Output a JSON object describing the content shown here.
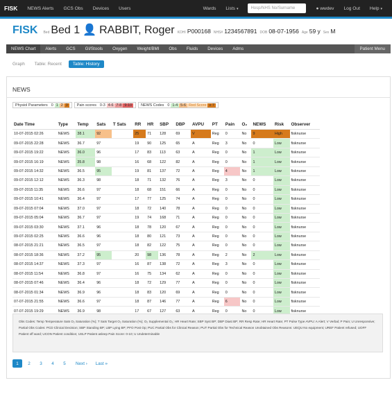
{
  "topnav": {
    "brand": "FISK",
    "left_items": [
      "NEWS Alerts",
      "GCS Obs",
      "Devices",
      "Users"
    ],
    "right_items": [
      "Wards",
      "Lists"
    ],
    "search_placeholder": "Hosp/NHS No/Surname",
    "user": "wwdev",
    "logout": "Log Out",
    "help": "Help"
  },
  "patient": {
    "ward": "FISK",
    "bed_label": "Bed",
    "bed": "Bed 1",
    "name": "RABBIT, Roger",
    "koha_label": "KOHI",
    "koha": "P000168",
    "nhs_label": "NHS#",
    "nhs": "1234567891",
    "dob_label": "DOB",
    "dob": "08-07-1956",
    "age_label": "Age",
    "age": "59 y",
    "sex_label": "Sex",
    "sex": "M"
  },
  "subnav": {
    "items": [
      "NEWS Chart",
      "Alerts",
      "GCS",
      "GI/Stools",
      "Oxygen",
      "Weight/BMI",
      "Obs",
      "Fluids",
      "Devices",
      "Adms"
    ],
    "patient_menu": "Patient Menu"
  },
  "tabs": [
    "Graph",
    "Table: Recent",
    "Table: History"
  ],
  "section_title": "NEWS",
  "legend": {
    "physiol_label": "Physiol Parameters",
    "physiol": [
      "0",
      "1",
      "2",
      "3"
    ],
    "pain_label": "Pain scores",
    "pain": [
      "0-3",
      "4-6",
      "7-8",
      "9-10"
    ],
    "codes_label": "NEWS Codes",
    "codes": [
      "0",
      "1-4",
      "5-6",
      "Red Score",
      "≥ 7"
    ]
  },
  "table": {
    "headers": [
      "Date Time",
      "Type",
      "Temp",
      "Sats",
      "T Sats",
      "RR",
      "HR",
      "SBP",
      "DBP",
      "AVPU",
      "PT",
      "Pain",
      "O₂",
      "NEWS",
      "Risk",
      "Observer"
    ],
    "rows": [
      [
        "10-07-2015 02:26",
        "NEWS",
        "38.1",
        "92",
        "",
        "25",
        "71",
        "128",
        "69",
        "V",
        "Reg",
        "0",
        "No",
        "9",
        "High",
        "fisknurse"
      ],
      [
        "09-07-2015 22:28",
        "NEWS",
        "36.7",
        "97",
        "",
        "19",
        "90",
        "125",
        "65",
        "A",
        "Reg",
        "3",
        "No",
        "0",
        "Low",
        "fisknurse"
      ],
      [
        "09-07-2015 19:22",
        "NEWS",
        "36.0",
        "96",
        "",
        "17",
        "83",
        "113",
        "63",
        "A",
        "Reg",
        "0",
        "No",
        "1",
        "Low",
        "fisknurse"
      ],
      [
        "09-07-2015 16:19",
        "NEWS",
        "35.8",
        "98",
        "",
        "16",
        "68",
        "122",
        "82",
        "A",
        "Reg",
        "0",
        "No",
        "1",
        "Low",
        "fisknurse"
      ],
      [
        "09-07-2015 14:32",
        "NEWS",
        "36.5",
        "95",
        "",
        "19",
        "81",
        "137",
        "72",
        "A",
        "Reg",
        "4",
        "No",
        "1",
        "Low",
        "fisknurse"
      ],
      [
        "09-07-2015 12:12",
        "NEWS",
        "36.3",
        "98",
        "",
        "18",
        "71",
        "132",
        "76",
        "A",
        "Reg",
        "3",
        "No",
        "0",
        "Low",
        "fisknurse"
      ],
      [
        "09-07-2015 11:35",
        "NEWS",
        "36.6",
        "97",
        "",
        "18",
        "68",
        "151",
        "66",
        "A",
        "Reg",
        "0",
        "No",
        "0",
        "Low",
        "fisknurse"
      ],
      [
        "09-07-2015 10:41",
        "NEWS",
        "36.4",
        "97",
        "",
        "17",
        "77",
        "125",
        "74",
        "A",
        "Reg",
        "0",
        "No",
        "0",
        "Low",
        "fisknurse"
      ],
      [
        "09-07-2015 07:04",
        "NEWS",
        "37.0",
        "97",
        "",
        "18",
        "72",
        "140",
        "78",
        "A",
        "Reg",
        "0",
        "No",
        "0",
        "Low",
        "fisknurse"
      ],
      [
        "09-07-2015 05:04",
        "NEWS",
        "36.7",
        "97",
        "",
        "19",
        "74",
        "168",
        "71",
        "A",
        "Reg",
        "0",
        "No",
        "0",
        "Low",
        "fisknurse"
      ],
      [
        "09-07-2015 03:30",
        "NEWS",
        "37.1",
        "96",
        "",
        "18",
        "78",
        "120",
        "67",
        "A",
        "Reg",
        "0",
        "No",
        "0",
        "Low",
        "fisknurse"
      ],
      [
        "09-07-2015 02:25",
        "NEWS",
        "36.6",
        "96",
        "",
        "18",
        "80",
        "121",
        "73",
        "A",
        "Reg",
        "0",
        "No",
        "0",
        "Low",
        "fisknurse"
      ],
      [
        "08-07-2015 21:21",
        "NEWS",
        "36.5",
        "97",
        "",
        "18",
        "82",
        "122",
        "75",
        "A",
        "Reg",
        "0",
        "No",
        "0",
        "Low",
        "fisknurse"
      ],
      [
        "08-07-2015 18:36",
        "NEWS",
        "37.2",
        "95",
        "",
        "20",
        "98",
        "136",
        "78",
        "A",
        "Reg",
        "2",
        "No",
        "2",
        "Low",
        "fisknurse"
      ],
      [
        "08-07-2015 14:37",
        "NEWS",
        "37.3",
        "97",
        "",
        "16",
        "87",
        "138",
        "72",
        "A",
        "Reg",
        "3",
        "No",
        "0",
        "Low",
        "fisknurse"
      ],
      [
        "08-07-2015 11:54",
        "NEWS",
        "36.8",
        "97",
        "",
        "16",
        "75",
        "134",
        "62",
        "A",
        "Reg",
        "0",
        "No",
        "0",
        "Low",
        "fisknurse"
      ],
      [
        "08-07-2015 07:46",
        "NEWS",
        "36.4",
        "96",
        "",
        "18",
        "72",
        "129",
        "77",
        "A",
        "Reg",
        "0",
        "No",
        "0",
        "Low",
        "fisknurse"
      ],
      [
        "08-07-2015 01:34",
        "NEWS",
        "36.9",
        "96",
        "",
        "18",
        "83",
        "120",
        "69",
        "A",
        "Reg",
        "0",
        "No",
        "0",
        "Low",
        "fisknurse"
      ],
      [
        "07-07-2015 21:55",
        "NEWS",
        "36.6",
        "97",
        "",
        "18",
        "87",
        "146",
        "77",
        "A",
        "Reg",
        "6",
        "No",
        "0",
        "Low",
        "fisknurse"
      ],
      [
        "07-07-2015 19:29",
        "NEWS",
        "36.9",
        "98",
        "",
        "17",
        "67",
        "127",
        "63",
        "A",
        "Reg",
        "0",
        "No",
        "0",
        "Low",
        "fisknurse"
      ]
    ],
    "highlights": [
      {
        "row": 0,
        "col": 2,
        "color": "#cdeecd"
      },
      {
        "row": 0,
        "col": 3,
        "color": "#f7c08a"
      },
      {
        "row": 0,
        "col": 5,
        "color": "#d67a1c"
      },
      {
        "row": 0,
        "col": 9,
        "color": "#d67a1c"
      },
      {
        "row": 0,
        "col": 13,
        "color": "#d67a1c"
      },
      {
        "row": 0,
        "col": 14,
        "color": "#d67a1c"
      },
      {
        "row": 2,
        "col": 2,
        "color": "#cdeecd"
      },
      {
        "row": 2,
        "col": 13,
        "color": "#cdeecd"
      },
      {
        "row": 3,
        "col": 2,
        "color": "#cdeecd"
      },
      {
        "row": 3,
        "col": 13,
        "color": "#cdeecd"
      },
      {
        "row": 4,
        "col": 3,
        "color": "#cdeecd"
      },
      {
        "row": 4,
        "col": 11,
        "color": "#f7c7c7"
      },
      {
        "row": 4,
        "col": 13,
        "color": "#cdeecd"
      },
      {
        "row": 13,
        "col": 3,
        "color": "#cdeecd"
      },
      {
        "row": 13,
        "col": 6,
        "color": "#cdeecd"
      },
      {
        "row": 13,
        "col": 13,
        "color": "#cdeecd"
      },
      {
        "row": 18,
        "col": 11,
        "color": "#f7c7c7"
      }
    ],
    "risk_low_color": "#cdeecd"
  },
  "obs_codes": {
    "text": "Obs Codes: Temp Temperature Sats O₂ Saturation (%); T Sats Target O₂ Saturation (%); O₂ Supplemental O₂; HR Heart Rate; SBP Syst BP; DBP Diast BP; RR Resp Rate; HR Heart Rate; PT Pulse Type AVPU: A Alert; V Verbal; P Pain; U Unresponsive; Partial Obs Codes: PCD Clinical Decision; SBP Standing BP; LBP Lying BP; PFO Post Op; PUC Partial Obs for Clinical Reason; PUT Partial Obs for Technical Reason Unobtained Obs Reasons: UEQU No equipment; UREF Patient refused; UOFF Patient off ward; UCON Patient condition; USLP Patient asleep Pain Score: 0-10; U Undeterminable"
  },
  "pager": {
    "pages": [
      "1",
      "2",
      "3",
      "4",
      "5"
    ],
    "next": "Next ›",
    "last": "Last »"
  },
  "colors": {
    "accent": "#1e88c7",
    "topbar": "#222222",
    "subnav": "#555555"
  }
}
